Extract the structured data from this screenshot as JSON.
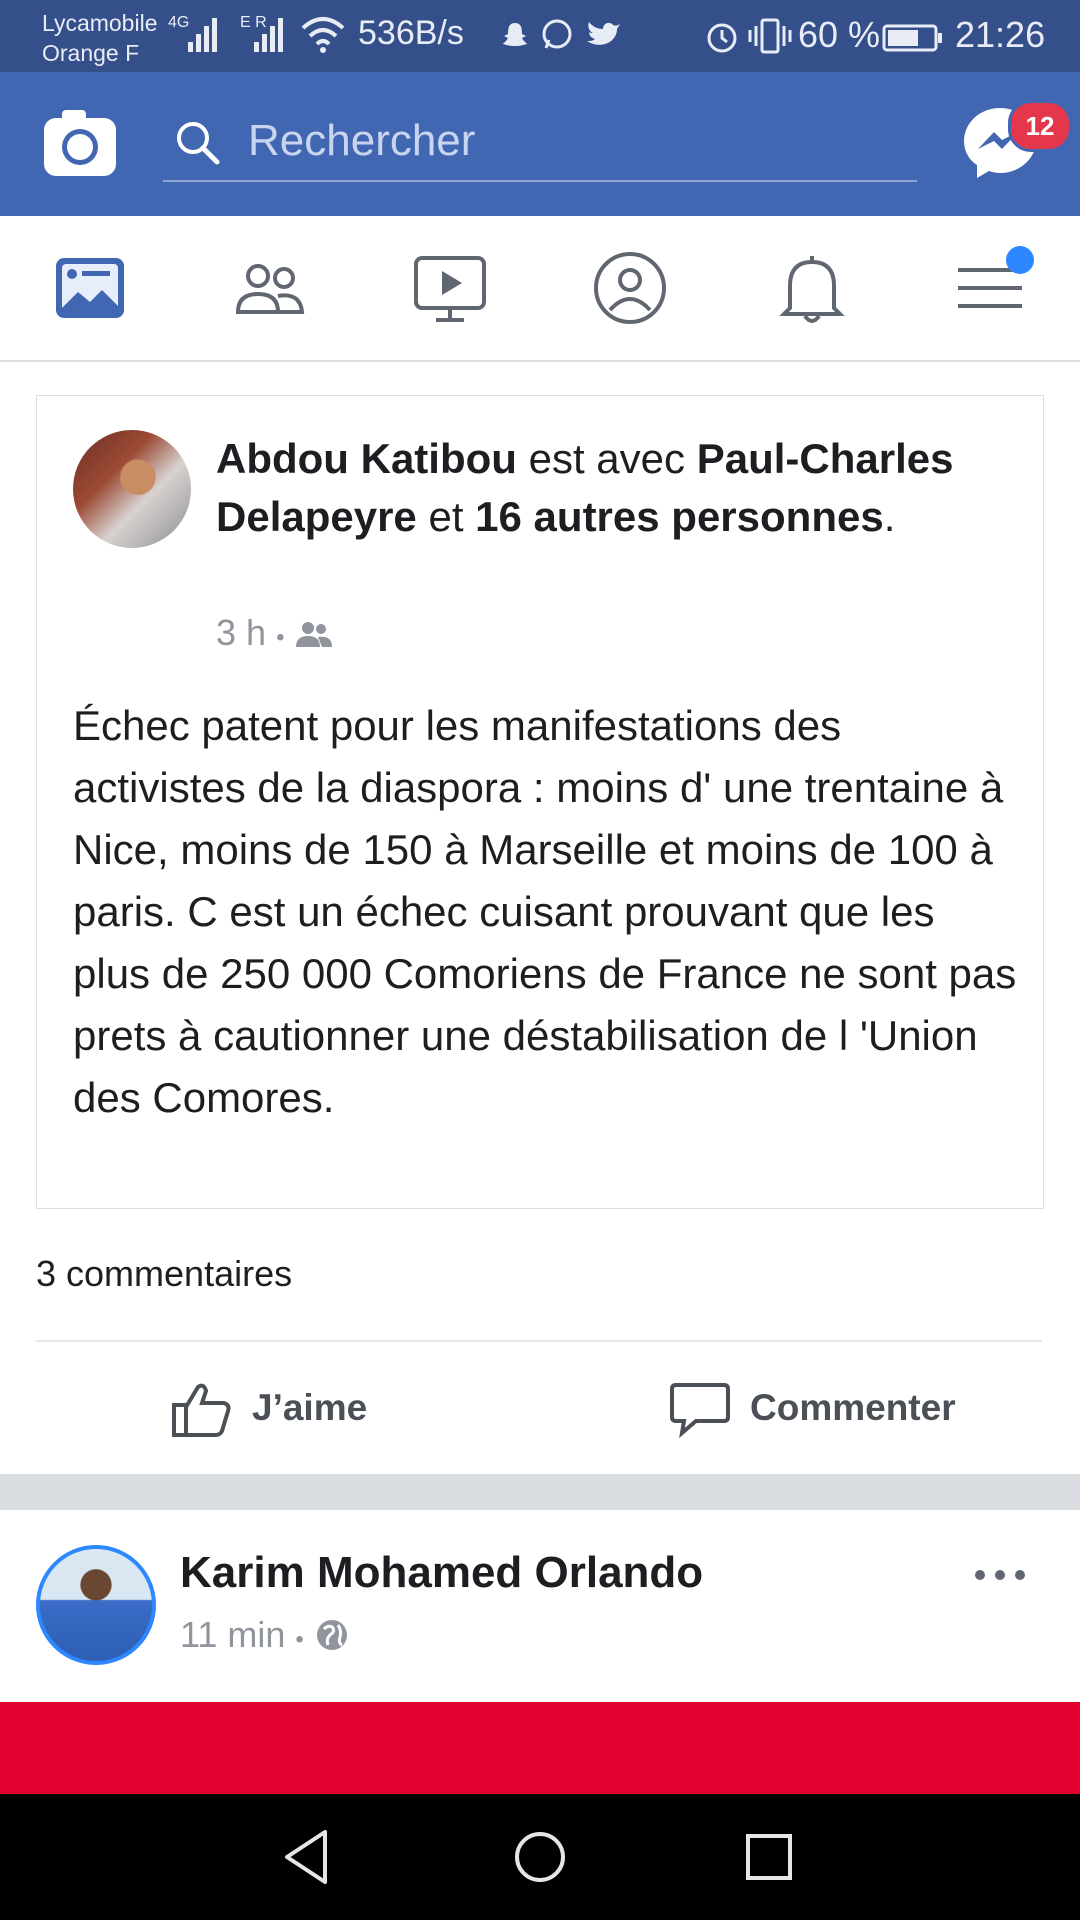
{
  "status_bar": {
    "carrier_1": "Lycamobile",
    "carrier_2": "Orange F",
    "net_1": "4G",
    "net_2": "E R",
    "net_speed": "536B/s",
    "battery": "60 %",
    "time": "21:26"
  },
  "header": {
    "search_placeholder": "Rechercher",
    "messenger_badge": "12"
  },
  "nav": {
    "tabs": [
      "news-feed",
      "friends",
      "watch",
      "profile",
      "notifications",
      "menu"
    ]
  },
  "shared_post": {
    "author": "Abdou Katibou",
    "with_text": " est avec ",
    "tagged": "Paul-Charles Delapeyre",
    "and_text": " et ",
    "others": "16 autres personnes",
    "period": ".",
    "time": "3 h",
    "dot": "•",
    "body": "Échec patent pour les manifestations  des activistes  de la diaspora : moins d' une trentaine  à  Nice,  moins de 150 à Marseille et moins de 100 à  paris. C est un échec  cuisant  prouvant que les plus de 250 000 Comoriens  de France  ne sont pas prets à  cautionner une déstabilisation  de l 'Union des Comores."
  },
  "post_footer": {
    "comments": "3 commentaires",
    "like_label": "J’aime",
    "comment_label": "Commenter"
  },
  "next_post": {
    "author": "Karim Mohamed Orlando",
    "time": "11 min",
    "dot": "•"
  },
  "colors": {
    "header_blue": "#4267b2",
    "status_blue": "#354f8a",
    "badge_red": "#e4374c",
    "band_red": "#e2002f",
    "accent_blue": "#2d88ff"
  }
}
